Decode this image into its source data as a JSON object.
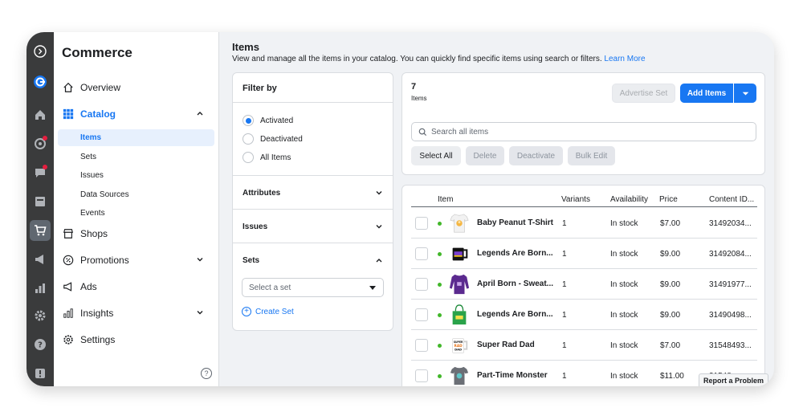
{
  "app": {
    "title": "Commerce"
  },
  "sidebar": {
    "overview": "Overview",
    "catalog": "Catalog",
    "catalog_items": [
      "Items",
      "Sets",
      "Issues",
      "Data Sources",
      "Events"
    ],
    "shops": "Shops",
    "promotions": "Promotions",
    "ads": "Ads",
    "insights": "Insights",
    "settings": "Settings",
    "help": "?"
  },
  "header": {
    "title": "Items",
    "description": "View and manage all the items in your catalog. You can quickly find specific items using search or filters.",
    "learn_more": "Learn More"
  },
  "filter": {
    "title": "Filter by",
    "options": [
      "Activated",
      "Deactivated",
      "All Items"
    ],
    "selected": "Activated",
    "attributes": "Attributes",
    "issues": "Issues",
    "sets": "Sets",
    "select_set_placeholder": "Select a set",
    "create_set": "Create Set"
  },
  "toolbar": {
    "count": "7",
    "count_label": "Items",
    "advertise_set": "Advertise Set",
    "add_items": "Add Items",
    "search_placeholder": "Search all items",
    "select_all": "Select All",
    "delete": "Delete",
    "deactivate": "Deactivate",
    "bulk_edit": "Bulk Edit"
  },
  "table": {
    "columns": [
      "Item",
      "Variants",
      "Availability",
      "Price",
      "Content ID..."
    ],
    "rows": [
      {
        "name": "Baby Peanut T-Shirt",
        "variants": "1",
        "availability": "In stock",
        "price": "$7.00",
        "content_id": "31492034..."
      },
      {
        "name": "Legends Are Born...",
        "variants": "1",
        "availability": "In stock",
        "price": "$9.00",
        "content_id": "31492084..."
      },
      {
        "name": "April Born - Sweat...",
        "variants": "1",
        "availability": "In stock",
        "price": "$9.00",
        "content_id": "31491977..."
      },
      {
        "name": "Legends Are Born...",
        "variants": "1",
        "availability": "In stock",
        "price": "$9.00",
        "content_id": "31490498..."
      },
      {
        "name": "Super Rad Dad",
        "variants": "1",
        "availability": "In stock",
        "price": "$7.00",
        "content_id": "31548493..."
      },
      {
        "name": "Part-Time Monster",
        "variants": "1",
        "availability": "In stock",
        "price": "$11.00",
        "content_id": "31548..."
      }
    ],
    "thumb_labels": {
      "super_rad_dad": "SUPER RAD DAD"
    }
  },
  "report_problem": "Report a Problem",
  "colors": {
    "accent": "#1877f2",
    "rail": "#3a3b3c",
    "status_green": "#42b72a"
  }
}
